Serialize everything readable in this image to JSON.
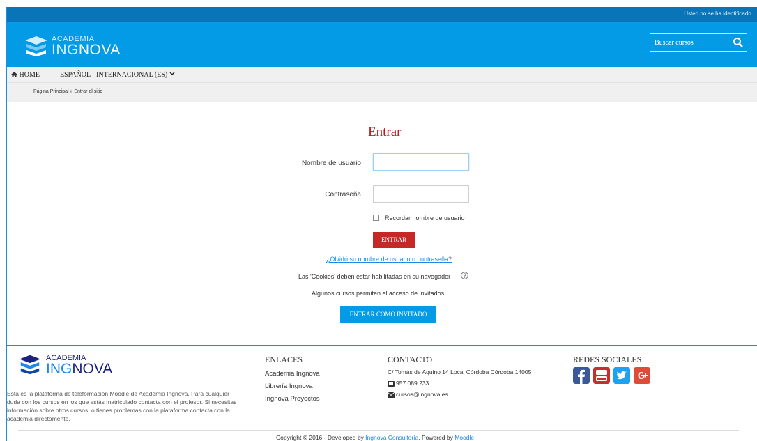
{
  "topbar": {
    "notice": "Usted no se ha identificado."
  },
  "brand": {
    "line1": "ACADEMIA",
    "line2a": "ING",
    "line2b": "NOVA"
  },
  "search": {
    "placeholder": "Buscar cursos"
  },
  "nav": {
    "home": "HOME",
    "language": "ESPAÑOL - INTERNACIONAL (ES)"
  },
  "breadcrumb": {
    "text": "Página Principal » Entrar al sitio"
  },
  "login": {
    "title": "Entrar",
    "username_label": "Nombre de usuario",
    "username_value": "",
    "password_label": "Contraseña",
    "password_value": "",
    "remember_label": "Recordar nombre de usuario",
    "submit_label": "ENTRAR",
    "forgot_link": "¿Olvidó su nombre de usuario o contraseña?",
    "cookies_note": "Las 'Cookies' deben estar habilitadas en su navegador",
    "guests_note": "Algunos cursos permiten el acceso de invitados",
    "guest_button": "ENTRAR COMO INVITADO"
  },
  "footer": {
    "description": "Esta es la plataforma de teleformación Moodle de Academia Ingnova. Para cualquier duda con los cursos en los que estás matriculado contacta con el profesor. Si necesitas información sobre otros cursos, o tienes problemas con la plataforma contacta con la academia directamente.",
    "links_heading": "ENLACES",
    "links": [
      "Academia Ingnova",
      "Librería Ingnova",
      "Ingnova Proyectos"
    ],
    "contact_heading": "CONTACTO",
    "address": "C/ Tomás de Aquino 14 Local Córdoba Córdoba 14005",
    "phone": "957 089 233",
    "email": "cursos@ingnova.es",
    "social_heading": "REDES SOCIALES",
    "social_icons": [
      "facebook-icon",
      "youtube-icon",
      "twitter-icon",
      "google-plus-icon"
    ],
    "copyright_prefix": "Copyright © 2016 - Developed by ",
    "copyright_dev": "Ingnova Consultoría",
    "copyright_mid": ". Powered by ",
    "copyright_moodle": "Moodle"
  },
  "colors": {
    "topbar": "#0a74b8",
    "header": "#039be5",
    "title_red": "#b71c1c",
    "button_red": "#c62828",
    "button_blue": "#039be5"
  }
}
